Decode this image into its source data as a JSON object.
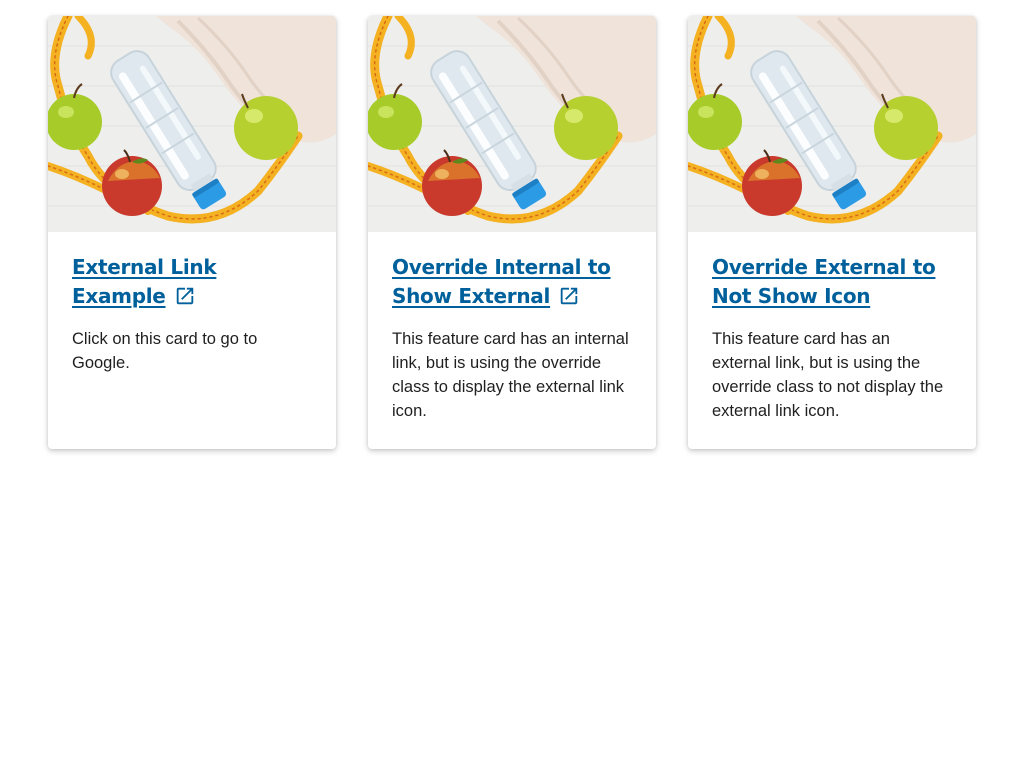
{
  "colors": {
    "link": "#00609c",
    "text": "#1f1f1f",
    "card_bg": "#ffffff"
  },
  "image": {
    "alt": "Green and red apples, a water bottle, a measuring tape and a towel"
  },
  "cards": [
    {
      "title": "External Link Example",
      "shows_external_icon": true,
      "icon": "external-link-icon",
      "description": "Click on this card to go to Google."
    },
    {
      "title": "Override Internal to Show External",
      "shows_external_icon": true,
      "icon": "external-link-icon",
      "description": "This feature card has an internal link, but is using the override class to display the external link icon."
    },
    {
      "title": "Override External to Not Show Icon",
      "shows_external_icon": false,
      "description": "This feature card has an external link, but is using the override class to not display the external link icon."
    }
  ]
}
